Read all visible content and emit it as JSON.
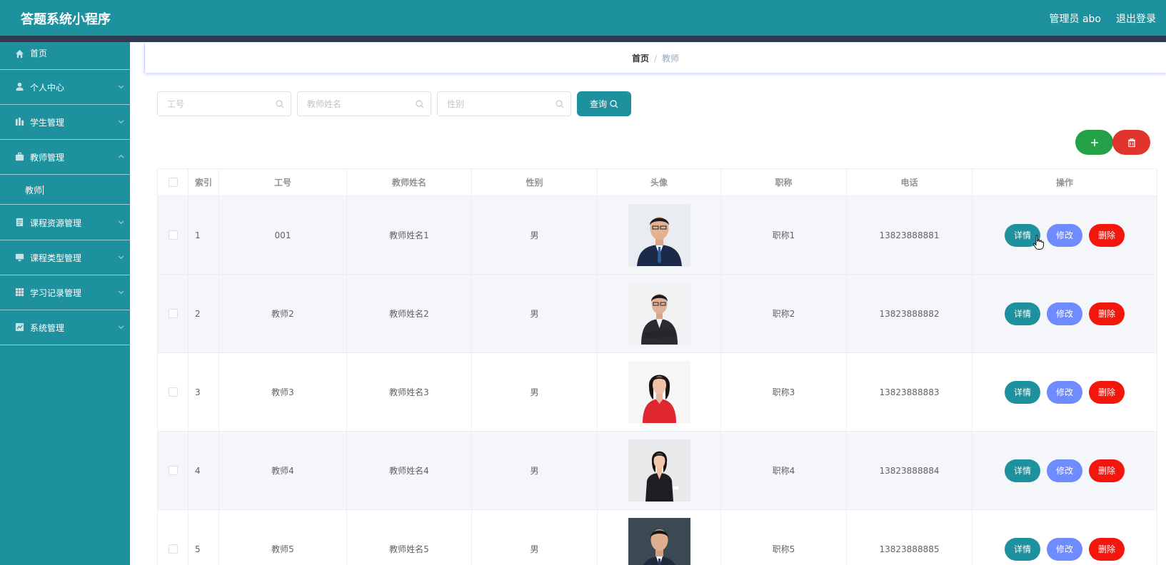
{
  "app": {
    "title": "答题系统小程序"
  },
  "header": {
    "user": "管理员 abo",
    "logout": "退出登录"
  },
  "sidebar": {
    "items": [
      {
        "label": "首页",
        "icon": "home-icon",
        "expandable": false
      },
      {
        "label": "个人中心",
        "icon": "user-icon",
        "expandable": true
      },
      {
        "label": "学生管理",
        "icon": "chart-bar-icon",
        "expandable": true
      },
      {
        "label": "教师管理",
        "icon": "briefcase-icon",
        "expandable": true,
        "expanded": true,
        "children": [
          {
            "label": "教师"
          }
        ]
      },
      {
        "label": "课程资源管理",
        "icon": "document-icon",
        "expandable": true
      },
      {
        "label": "课程类型管理",
        "icon": "monitor-icon",
        "expandable": true
      },
      {
        "label": "学习记录管理",
        "icon": "grid-icon",
        "expandable": true
      },
      {
        "label": "系统管理",
        "icon": "system-icon",
        "expandable": true
      }
    ]
  },
  "breadcrumb": {
    "home": "首页",
    "separator": "/",
    "current": "教师"
  },
  "search": {
    "fields": [
      {
        "placeholder": "工号",
        "value": ""
      },
      {
        "placeholder": "教师姓名",
        "value": ""
      },
      {
        "placeholder": "性别",
        "value": ""
      }
    ],
    "button_label": "查询"
  },
  "toolbar": {
    "add_icon": "plus-icon",
    "delete_icon": "trash-icon"
  },
  "table": {
    "columns": [
      "索引",
      "工号",
      "教师姓名",
      "性别",
      "头像",
      "职称",
      "电话",
      "操作"
    ],
    "rows": [
      {
        "index": "1",
        "id": "001",
        "name": "教师姓名1",
        "gender": "男",
        "avatar": "man-in-navy-suit",
        "title": "职称1",
        "phone": "13823888881"
      },
      {
        "index": "2",
        "id": "教师2",
        "name": "教师姓名2",
        "gender": "男",
        "avatar": "man-arms-crossed",
        "title": "职称2",
        "phone": "13823888882"
      },
      {
        "index": "3",
        "id": "教师3",
        "name": "教师姓名3",
        "gender": "男",
        "avatar": "woman-in-red",
        "title": "职称3",
        "phone": "13823888883"
      },
      {
        "index": "4",
        "id": "教师4",
        "name": "教师姓名4",
        "gender": "男",
        "avatar": "woman-seated-black-suit",
        "title": "职称4",
        "phone": "13823888884"
      },
      {
        "index": "5",
        "id": "教师5",
        "name": "教师姓名5",
        "gender": "男",
        "avatar": "man-dark-suit",
        "title": "职称5",
        "phone": "13823888885"
      }
    ],
    "actions": {
      "detail": "详情",
      "edit": "修改",
      "delete": "删除"
    }
  },
  "colors": {
    "primary": "#1e919e",
    "header_strip": "#2d3a4f",
    "add": "#24a047",
    "danger": "#f3160c",
    "edit": "#6e8bff"
  }
}
